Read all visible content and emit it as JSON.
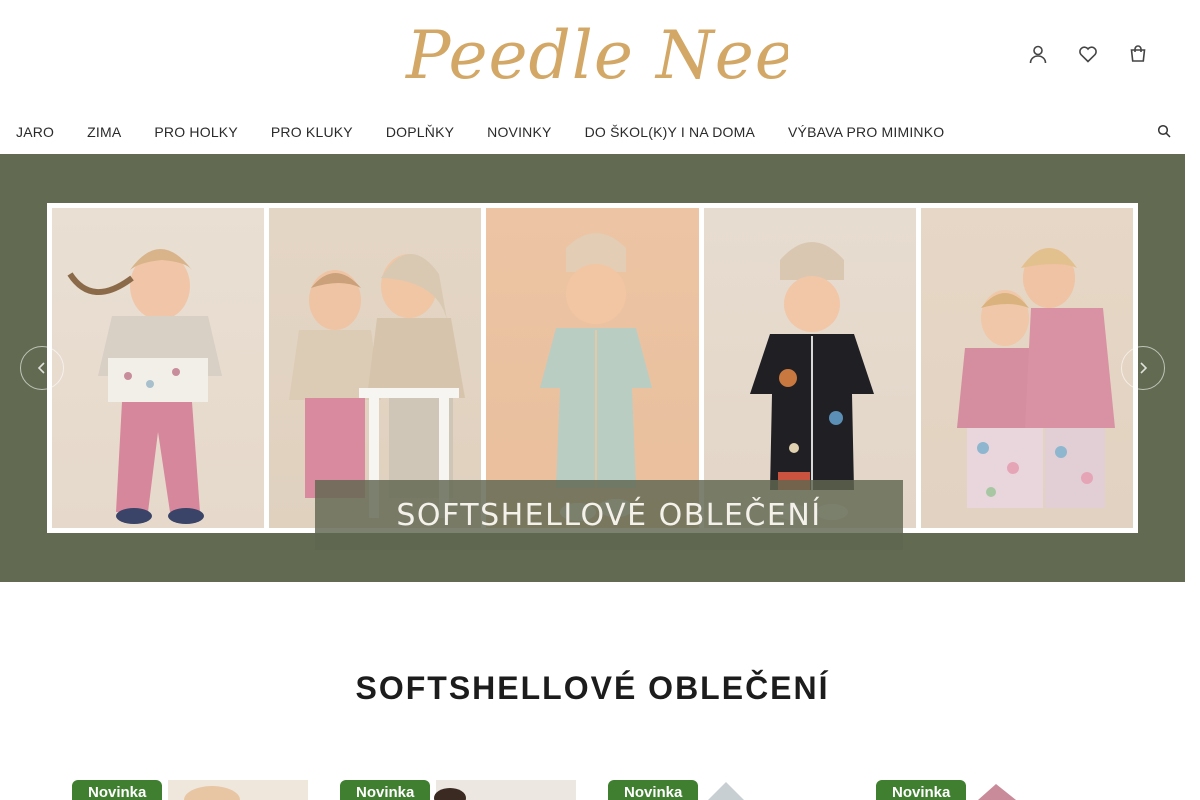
{
  "brand": {
    "logo_text": "Peedle Needle",
    "accent": "#d3a867"
  },
  "header_icons": [
    {
      "name": "user-icon"
    },
    {
      "name": "heart-icon"
    },
    {
      "name": "cart-icon"
    }
  ],
  "nav": {
    "items": [
      {
        "label": "JARO"
      },
      {
        "label": "ZIMA"
      },
      {
        "label": "PRO HOLKY"
      },
      {
        "label": "PRO KLUKY"
      },
      {
        "label": "DOPLŇKY"
      },
      {
        "label": "NOVINKY"
      },
      {
        "label": "DO ŠKOL(K)Y I NA DOMA"
      },
      {
        "label": "VÝBAVA PRO MIMINKO"
      }
    ],
    "search_icon": "search-icon"
  },
  "hero": {
    "banner_text": "SOFTSHELLOVÉ OBLEČENÍ",
    "background": "#626a51",
    "prev_icon": "chevron-left-icon",
    "next_icon": "chevron-right-icon"
  },
  "section": {
    "title": "SOFTSHELLOVÉ OBLEČENÍ"
  },
  "products": [
    {
      "badge": "Novinka"
    },
    {
      "badge": "Novinka"
    },
    {
      "badge": "Novinka"
    },
    {
      "badge": "Novinka"
    }
  ],
  "colors": {
    "badge": "#3f7f2f"
  }
}
